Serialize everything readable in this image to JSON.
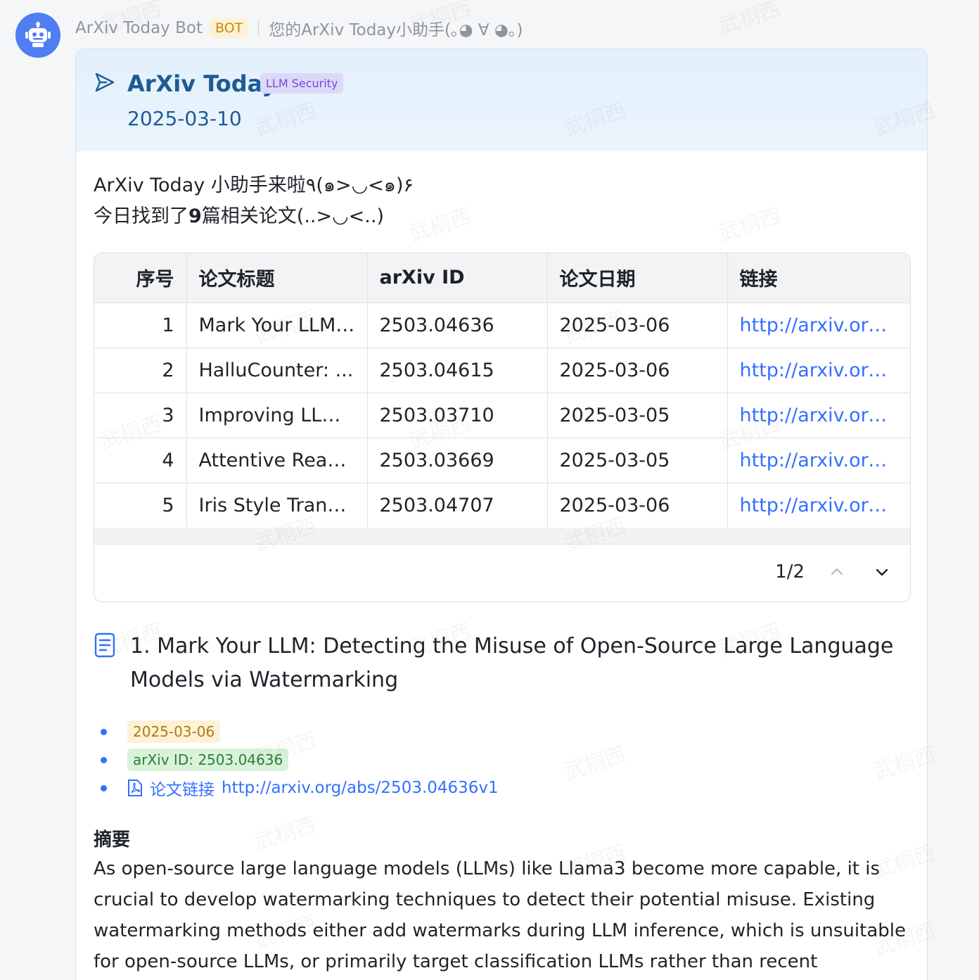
{
  "sender": {
    "name": "ArXiv Today Bot",
    "badge": "BOT",
    "description": "您的ArXiv Today小助手(｡◕ ∀ ◕｡)"
  },
  "card": {
    "title": "ArXiv Today",
    "topic_tag": "LLM Security",
    "date": "2025-03-10",
    "intro_line1": "ArXiv Today 小助手来啦٩(๑>◡<๑)۶",
    "intro_prefix": "今日找到了",
    "intro_count": "9",
    "intro_suffix": "篇相关论文(..>◡<..)"
  },
  "table": {
    "headers": [
      "序号",
      "论文标题",
      "arXiv ID",
      "论文日期",
      "链接"
    ],
    "rows": [
      [
        "1",
        "Mark Your LLM:...",
        "2503.04636",
        "2025-03-06",
        "http://arxiv.org/..."
      ],
      [
        "2",
        "HalluCounter: ...",
        "2503.04615",
        "2025-03-06",
        "http://arxiv.org/..."
      ],
      [
        "3",
        "Improving LLM ...",
        "2503.03710",
        "2025-03-05",
        "http://arxiv.org/..."
      ],
      [
        "4",
        "Attentive Reas...",
        "2503.03669",
        "2025-03-05",
        "http://arxiv.org/..."
      ],
      [
        "5",
        "Iris Style Transf...",
        "2503.04707",
        "2025-03-06",
        "http://arxiv.org/..."
      ]
    ],
    "pagination": "1/2"
  },
  "paper": {
    "title": "1. Mark Your LLM: Detecting the Misuse of Open-Source Large Language Models via Watermarking",
    "date_tag": "2025-03-06",
    "id_tag": "arXiv ID: 2503.04636",
    "link_label": "论文链接",
    "link_url": "http://arxiv.org/abs/2503.04636v1",
    "abstract_heading": "摘要",
    "abstract": "As open-source large language models (LLMs) like Llama3 become more capable, it is crucial to develop watermarking techniques to detect their potential misuse. Existing watermarking methods either add watermarks during LLM inference, which is unsuitable for open-source LLMs, or primarily target classification LLMs rather than recent"
  },
  "watermark": "武桐西",
  "colors": {
    "avatar": "#4f7df2",
    "header_text": "#1e5b96",
    "link": "#3370ff",
    "tag_topic_bg": "#ded8f8",
    "tag_date_bg": "#fdf1d6",
    "tag_id_bg": "#d9f2dc"
  },
  "icons": [
    "robot-icon",
    "send-icon",
    "chevron-up-icon",
    "chevron-down-icon",
    "document-icon",
    "pdf-icon"
  ]
}
